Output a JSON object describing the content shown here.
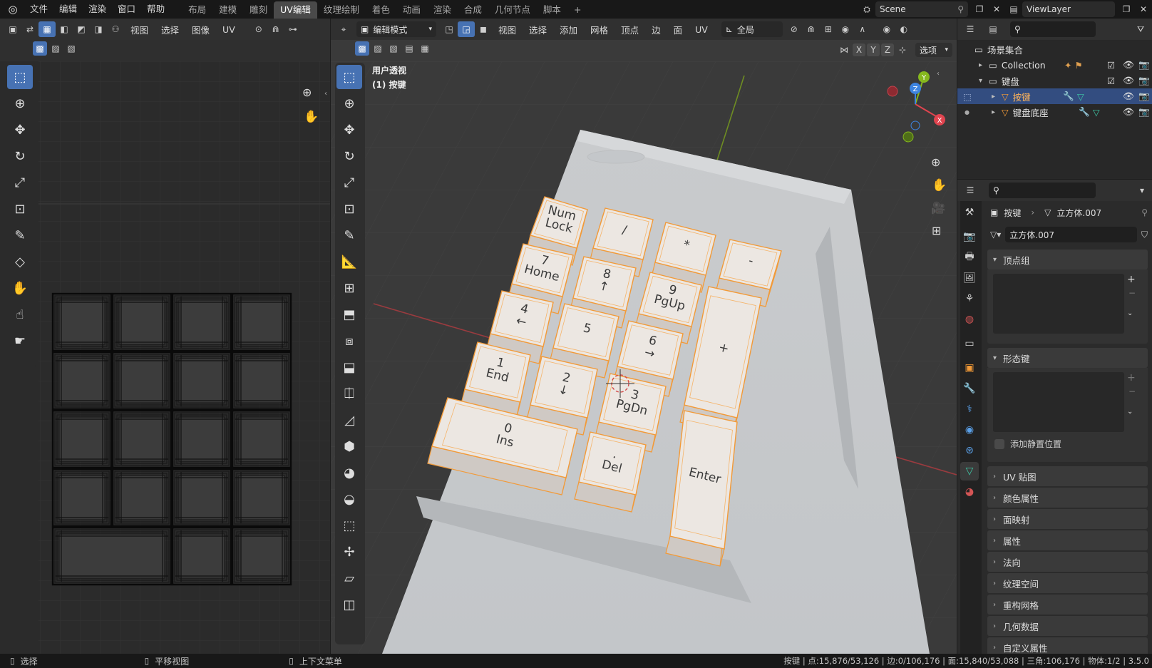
{
  "topbar": {
    "menus": [
      "文件",
      "编辑",
      "渲染",
      "窗口",
      "帮助"
    ],
    "workspace_tabs": [
      "布局",
      "建模",
      "雕刻",
      "UV编辑",
      "纹理绘制",
      "着色",
      "动画",
      "渲染",
      "合成",
      "几何节点",
      "脚本"
    ],
    "active_tab": "UV编辑",
    "add_tab": "+",
    "scene_label": "Scene",
    "viewlayer_label": "ViewLayer"
  },
  "uv_editor": {
    "header_menus": [
      "视图",
      "选择",
      "图像",
      "UV"
    ]
  },
  "viewport": {
    "mode_label": "编辑模式",
    "header_menus": [
      "视图",
      "选择",
      "添加",
      "网格",
      "顶点",
      "边",
      "面",
      "UV"
    ],
    "transform_orientation": "全局",
    "axis_labels": [
      "X",
      "Y",
      "Z"
    ],
    "options_label": "选项",
    "view_name": "用户透视",
    "object_info": "(1) 按键",
    "gizmo": {
      "x": "X",
      "y": "Y",
      "z": "Z"
    },
    "keys": {
      "numlock": "Num\nLock",
      "slash": "/",
      "star": "*",
      "minus": "-",
      "k7": "7\nHome",
      "k8": "8\n↑",
      "k9": "9\nPgUp",
      "k4": "4\n←",
      "k5": "5",
      "k6": "6\n→",
      "plus": "+",
      "k1": "1\nEnd",
      "k2": "2\n↓",
      "k3": "3\nPgDn",
      "k0": "0\nIns",
      "del": ".\nDel",
      "enter": "Enter"
    }
  },
  "outliner": {
    "root": "场景集合",
    "items": [
      {
        "name": "Collection"
      },
      {
        "name": "键盘"
      },
      {
        "name": "按键"
      },
      {
        "name": "键盘底座"
      }
    ]
  },
  "properties": {
    "breadcrumb_object": "按键",
    "breadcrumb_mesh": "立方体.007",
    "mesh_name": "立方体.007",
    "panels": {
      "vertex_groups": "顶点组",
      "shape_keys": "形态键",
      "add_rest_position": "添加静置位置",
      "uv_maps": "UV 贴图",
      "color_attributes": "颜色属性",
      "face_maps": "面映射",
      "attributes": "属性",
      "normals": "法向",
      "texture_space": "纹理空间",
      "remesh": "重构网格",
      "geometry_data": "几何数据",
      "custom_properties": "自定义属性"
    }
  },
  "statusbar": {
    "select": "选择",
    "pan_view": "平移视图",
    "context_menu": "上下文菜单",
    "stats": "按键 | 点:15,876/53,126 | 边:0/106,176 | 面:15,840/53,088 | 三角:106,176 | 物体:1/2 | 3.5.0"
  },
  "colors": {
    "accent": "#4772b3",
    "selection_orange": "#f29a38",
    "x_axis": "#e0444f",
    "y_axis": "#86b81e",
    "z_axis": "#3d84e0",
    "key_body": "#d8d8d8"
  }
}
